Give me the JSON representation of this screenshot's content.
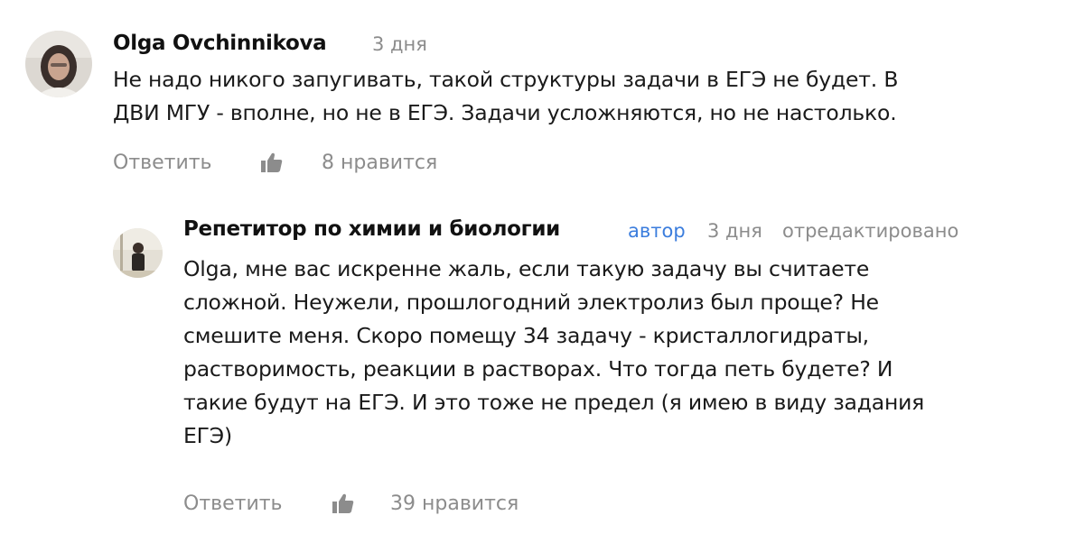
{
  "comments": [
    {
      "author": "Olga Ovchinnikova",
      "time": "3 дня",
      "text": "Не надо никого запугивать, такой структуры задачи в ЕГЭ не будет. В\nДВИ МГУ - вполне, но не в ЕГЭ. Задачи усложняются, но не настолько.",
      "reply_label": "Ответить",
      "likes_label": "8 нравится",
      "like_icon": "thumbs-up-icon"
    },
    {
      "author": "Репетитор по химии и биологии",
      "badge": "автор",
      "time": "3 дня",
      "edited": "отредактировано",
      "text": "Olga, мне вас искренне жаль, если такую задачу вы считаете\nсложной. Неужели, прошлогодний электролиз был проще? Не\nсмешите меня. Скоро помещу 34 задачу - кристаллогидраты,\nрастворимость, реакции в растворах. Что тогда петь будете? И\nтакие будут на ЕГЭ. И это тоже не предел (я имею в виду задания\nЕГЭ)",
      "reply_label": "Ответить",
      "likes_label": "39 нравится",
      "like_icon": "thumbs-up-icon"
    }
  ]
}
